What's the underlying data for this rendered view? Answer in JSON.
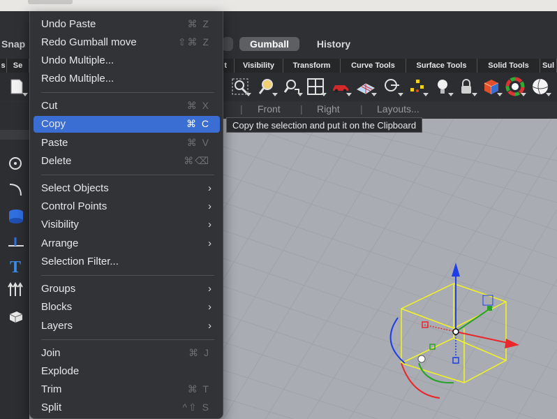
{
  "segments": {
    "snap": "Snap",
    "gumball": "Gumball",
    "history": "History"
  },
  "toolbar_tabs": [
    "s",
    "Se",
    "t",
    "Visibility",
    "Transform",
    "Curve Tools",
    "Surface Tools",
    "Solid Tools",
    "Sul"
  ],
  "view_tabs": {
    "front": "Front",
    "right": "Right",
    "layouts": "Layouts..."
  },
  "menu": {
    "items": [
      {
        "label": "Undo Paste",
        "shortcut": "⌘ Z"
      },
      {
        "label": "Redo Gumball move",
        "shortcut": "⇧⌘ Z"
      },
      {
        "label": "Undo Multiple...",
        "shortcut": ""
      },
      {
        "label": "Redo Multiple...",
        "shortcut": ""
      },
      {
        "label": "Cut",
        "shortcut": "⌘ X"
      },
      {
        "label": "Copy",
        "shortcut": "⌘ C"
      },
      {
        "label": "Paste",
        "shortcut": "⌘ V"
      },
      {
        "label": "Delete",
        "shortcut": "⌘⌫"
      },
      {
        "label": "Select Objects",
        "submenu": "›"
      },
      {
        "label": "Control Points",
        "submenu": "›"
      },
      {
        "label": "Visibility",
        "submenu": "›"
      },
      {
        "label": "Arrange",
        "submenu": "›"
      },
      {
        "label": "Selection Filter...",
        "shortcut": ""
      },
      {
        "label": "Groups",
        "submenu": "›"
      },
      {
        "label": "Blocks",
        "submenu": "›"
      },
      {
        "label": "Layers",
        "submenu": "›"
      },
      {
        "label": "Join",
        "shortcut": "⌘ J"
      },
      {
        "label": "Explode",
        "shortcut": ""
      },
      {
        "label": "Trim",
        "shortcut": "⌘ T"
      },
      {
        "label": "Split",
        "shortcut": "^⇧ S"
      }
    ]
  },
  "tooltip": "Copy the selection and put it on the Clipboard",
  "colors": {
    "menu_bg": "#323336",
    "highlight": "#3b6ed3",
    "viewport_bg": "#a9adb3",
    "gumball_x": "#e8282c",
    "gumball_y": "#2aa12a",
    "gumball_z": "#1f3ee8",
    "bbox": "#f5f51e"
  },
  "icons": {
    "toolbar": [
      "document-icon",
      "zoom-window-icon",
      "zoom-extents-icon",
      "rotate-view-icon",
      "viewport-layout-icon",
      "car-render-icon",
      "grid-plane-icon",
      "cplane-icon",
      "points-icon",
      "light-bulb-icon",
      "lock-icon",
      "box-icon",
      "color-wheel-icon",
      "sphere-icon"
    ],
    "left": [
      "circle-icon",
      "curve-icon",
      "solid-icon",
      "dimension-icon",
      "text-icon",
      "arrow-up-icon",
      "block-icon"
    ]
  }
}
